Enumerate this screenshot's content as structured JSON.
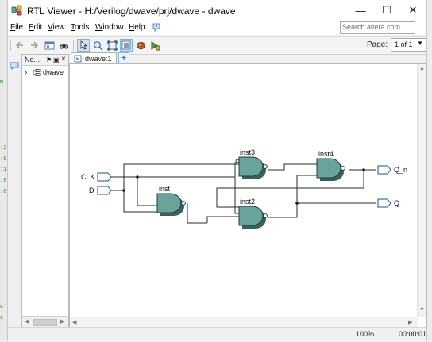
{
  "window": {
    "title": "RTL Viewer - H:/Verilog/dwave/prj/dwave - dwave",
    "controls": [
      "—",
      "☐",
      "✕"
    ]
  },
  "menu": {
    "items": [
      {
        "label": "File",
        "key": "F",
        "rest": "ile"
      },
      {
        "label": "Edit",
        "key": "E",
        "rest": "dit"
      },
      {
        "label": "View",
        "key": "V",
        "rest": "iew"
      },
      {
        "label": "Tools",
        "key": "T",
        "rest": "ools"
      },
      {
        "label": "Window",
        "key": "W",
        "rest": "indow"
      },
      {
        "label": "Help",
        "key": "H",
        "rest": "elp"
      }
    ],
    "search_placeholder": "Search altera.com"
  },
  "toolbar": {
    "page_label": "Page:",
    "page_value": "1 of 1"
  },
  "navigator": {
    "title": "Ne...",
    "pin": "⚑",
    "float": "▣",
    "close": "×",
    "tree": [
      {
        "label": "dwave",
        "expander": "›"
      }
    ]
  },
  "tabs": [
    {
      "label": "dwave:1"
    }
  ],
  "schematic": {
    "inputs": [
      "CLK",
      "D"
    ],
    "outputs": [
      "Q_n",
      "Q"
    ],
    "instances": [
      "inst3",
      "inst4",
      "inst",
      "inst2"
    ],
    "gate_color": "#6aa39c"
  },
  "status": {
    "zoom": "100%",
    "time": "00:00:01"
  },
  "background": {
    "left_glyphs": [
      "m",
      ":2",
      ":0",
      ":1",
      ":0",
      ":0",
      "c",
      "e"
    ]
  }
}
